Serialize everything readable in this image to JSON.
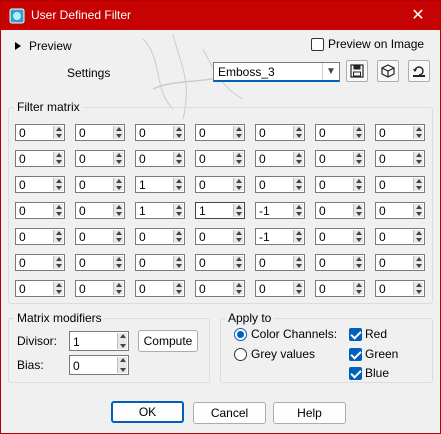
{
  "window": {
    "title": "User Defined Filter",
    "close_glyph": "✕",
    "accent_color": "#c60202"
  },
  "top": {
    "preview_label": "Preview",
    "preview_on_image_label": "Preview on Image",
    "preview_on_image_checked": false,
    "settings_label": "Settings",
    "settings_value": "Emboss_3",
    "tool_icons": [
      "save-icon",
      "cube-icon",
      "reset-icon"
    ]
  },
  "matrix": {
    "label": "Filter matrix",
    "rows": [
      [
        "0",
        "0",
        "0",
        "0",
        "0",
        "0",
        "0"
      ],
      [
        "0",
        "0",
        "0",
        "0",
        "0",
        "0",
        "0"
      ],
      [
        "0",
        "0",
        "1",
        "0",
        "0",
        "0",
        "0"
      ],
      [
        "0",
        "0",
        "1",
        "1",
        "-1",
        "0",
        "0"
      ],
      [
        "0",
        "0",
        "0",
        "0",
        "-1",
        "0",
        "0"
      ],
      [
        "0",
        "0",
        "0",
        "0",
        "0",
        "0",
        "0"
      ],
      [
        "0",
        "0",
        "0",
        "0",
        "0",
        "0",
        "0"
      ]
    ]
  },
  "modifiers": {
    "label": "Matrix modifiers",
    "divisor_label": "Divisor:",
    "divisor_value": "1",
    "compute_label": "Compute",
    "bias_label": "Bias:",
    "bias_value": "0"
  },
  "apply_to": {
    "label": "Apply to",
    "color_channels_label": "Color Channels:",
    "grey_values_label": "Grey values",
    "selected": "color_channels",
    "red_label": "Red",
    "green_label": "Green",
    "blue_label": "Blue",
    "red_checked": true,
    "green_checked": true,
    "blue_checked": true
  },
  "footer": {
    "ok_label": "OK",
    "cancel_label": "Cancel",
    "help_label": "Help"
  }
}
